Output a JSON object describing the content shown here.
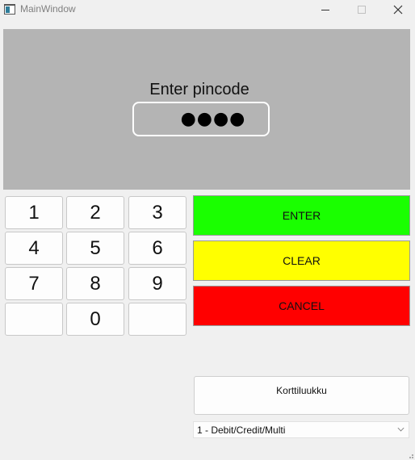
{
  "window": {
    "title": "MainWindow",
    "icons": {
      "app": "app-window-icon",
      "minimize": "minimize-icon",
      "maximize": "maximize-icon",
      "close": "close-icon"
    }
  },
  "display": {
    "prompt": "Enter pincode",
    "pin_masked": "●●●●"
  },
  "keypad": {
    "keys": [
      "1",
      "2",
      "3",
      "4",
      "5",
      "6",
      "7",
      "8",
      "9",
      "",
      "0",
      ""
    ]
  },
  "actions": {
    "enter_label": "ENTER",
    "clear_label": "CLEAR",
    "cancel_label": "CANCEL"
  },
  "card_slot": {
    "label": "Korttiluukku"
  },
  "card_type": {
    "selected": "1 - Debit/Credit/Multi"
  },
  "colors": {
    "display_bg": "#b4b4b4",
    "enter": "#1aff00",
    "clear": "#ffff00",
    "cancel": "#ff0000"
  }
}
